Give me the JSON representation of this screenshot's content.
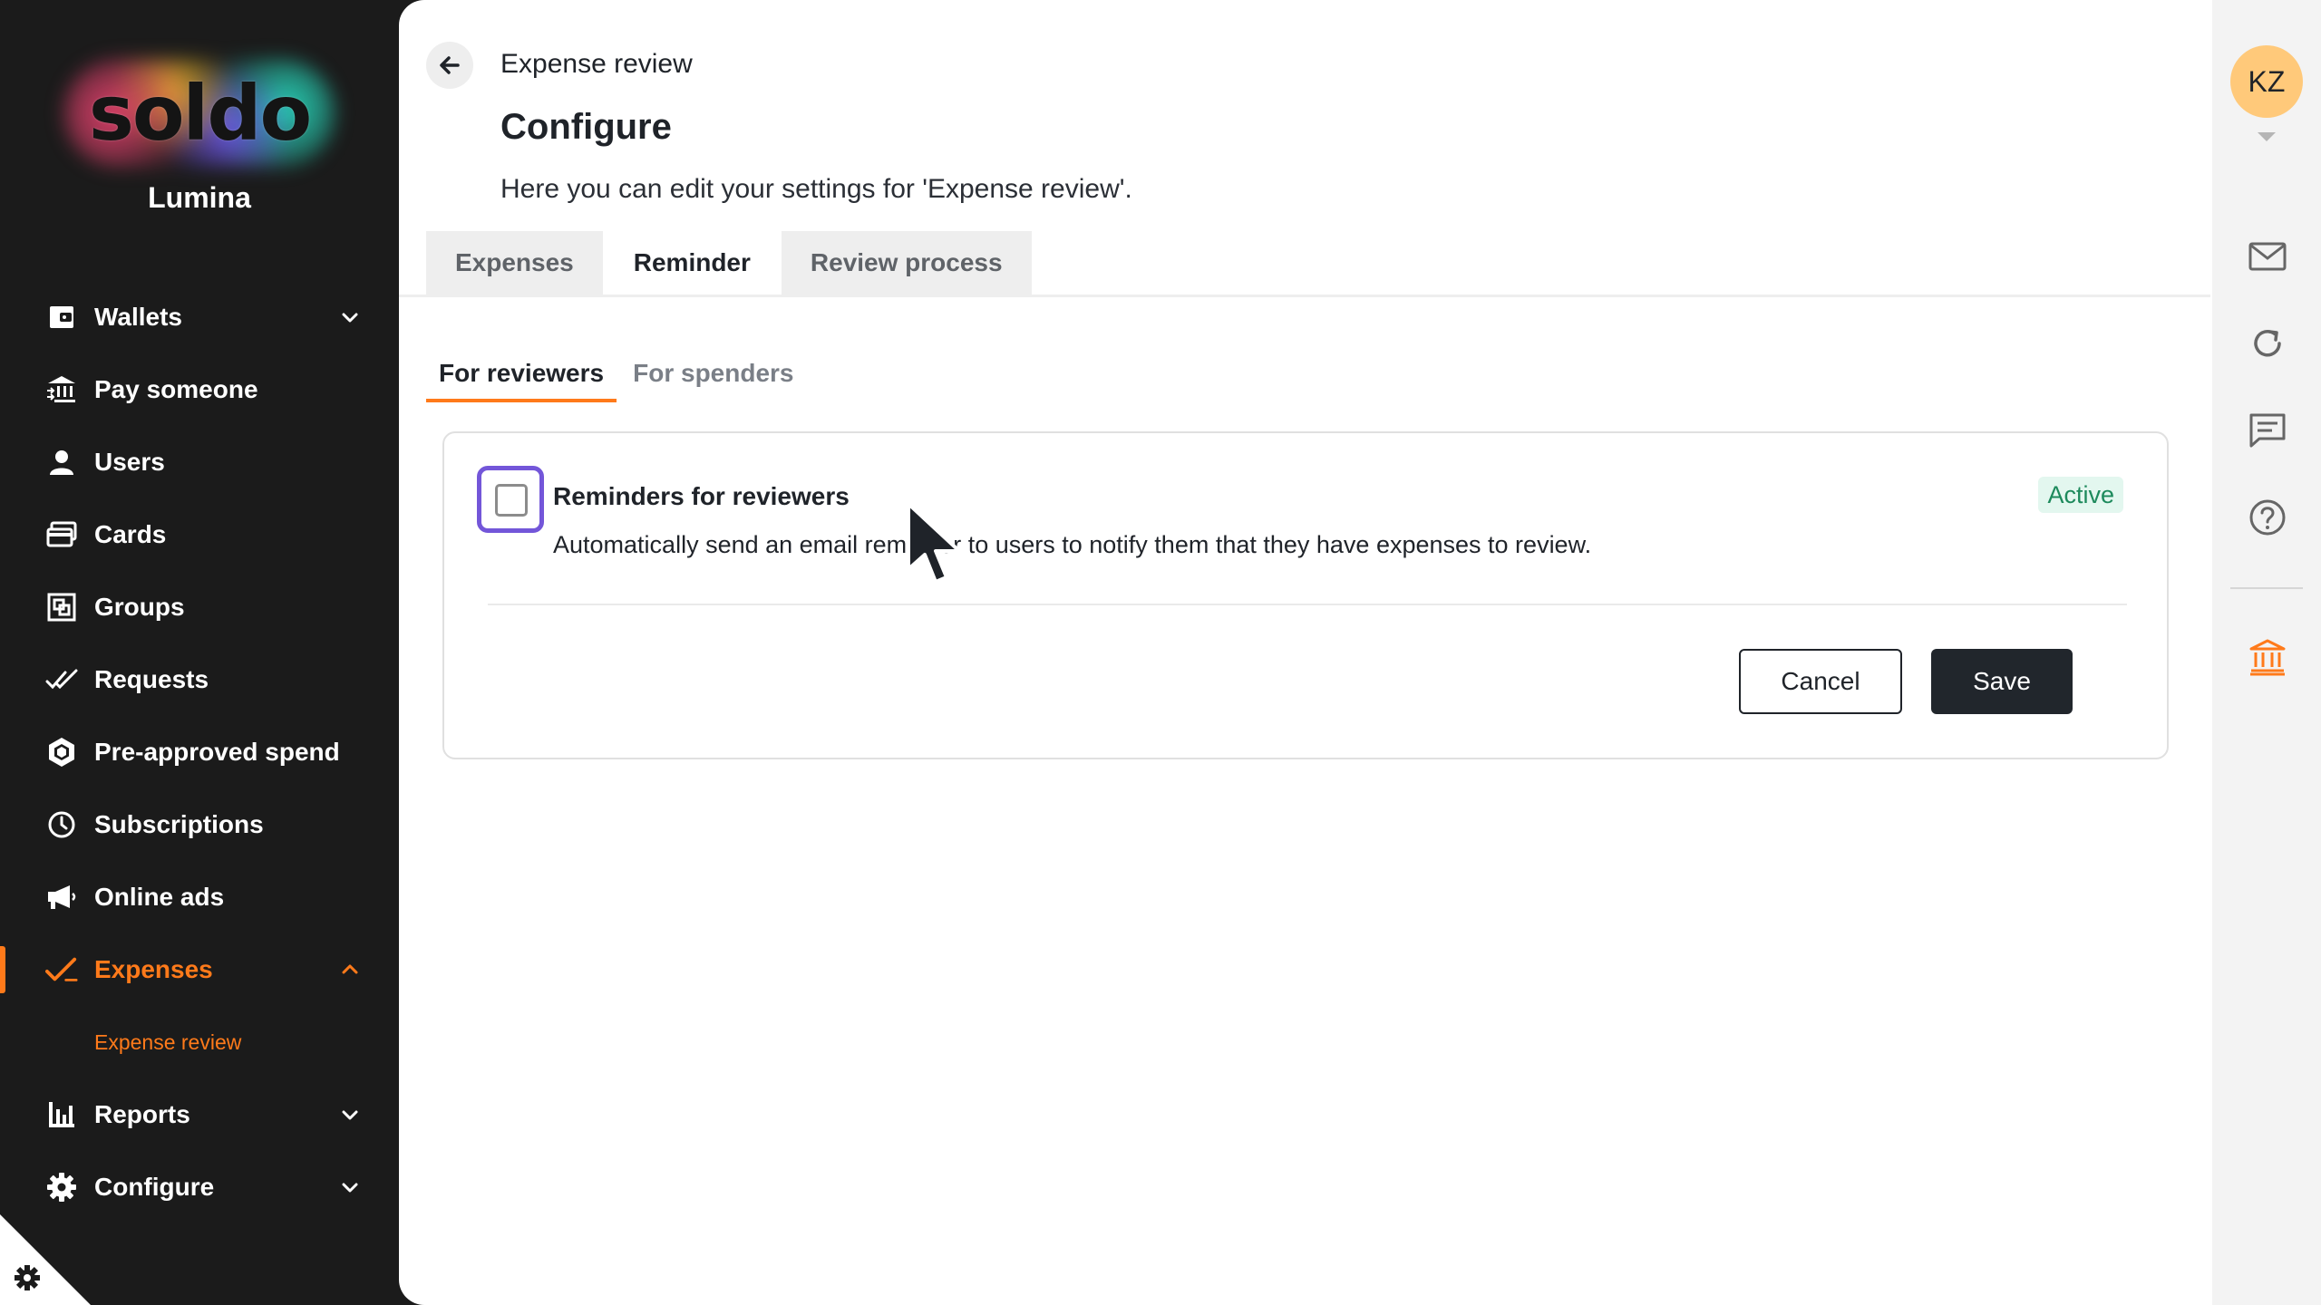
{
  "app": {
    "brand": "soldo",
    "org_name": "Lumina"
  },
  "sidebar": {
    "items": [
      {
        "label": "Wallets",
        "icon": "wallet-icon",
        "chevron": "down"
      },
      {
        "label": "Pay someone",
        "icon": "bank-transfer-icon"
      },
      {
        "label": "Users",
        "icon": "user-icon"
      },
      {
        "label": "Cards",
        "icon": "cards-icon"
      },
      {
        "label": "Groups",
        "icon": "groups-icon"
      },
      {
        "label": "Requests",
        "icon": "double-check-icon"
      },
      {
        "label": "Pre-approved spend",
        "icon": "hexagon-icon"
      },
      {
        "label": "Subscriptions",
        "icon": "clock-icon"
      },
      {
        "label": "Online ads",
        "icon": "megaphone-icon"
      },
      {
        "label": "Expenses",
        "icon": "check-pen-icon",
        "chevron": "up",
        "active": true
      },
      {
        "label": "Reports",
        "icon": "bar-chart-icon",
        "chevron": "down"
      },
      {
        "label": "Configure",
        "icon": "gear-icon",
        "chevron": "down"
      }
    ],
    "subitem": "Expense review",
    "accent_color": "#ff7a1a"
  },
  "header": {
    "breadcrumb": "Expense review",
    "title": "Configure",
    "description": "Here you can edit your settings for 'Expense review'."
  },
  "tabs": [
    {
      "label": "Expenses"
    },
    {
      "label": "Reminder",
      "active": true
    },
    {
      "label": "Review process"
    }
  ],
  "subtabs": [
    {
      "label": "For reviewers",
      "active": true
    },
    {
      "label": "For spenders"
    }
  ],
  "reminder_card": {
    "title": "Reminders for reviewers",
    "description": "Automatically send an email reminder to users to notify them that they have expenses to review.",
    "status": "Active",
    "checked": false,
    "cancel_label": "Cancel",
    "save_label": "Save"
  },
  "rail": {
    "avatar_initials": "KZ",
    "icons": [
      "mail-icon",
      "refresh-icon",
      "chat-icon",
      "help-icon",
      "bank-icon"
    ]
  }
}
